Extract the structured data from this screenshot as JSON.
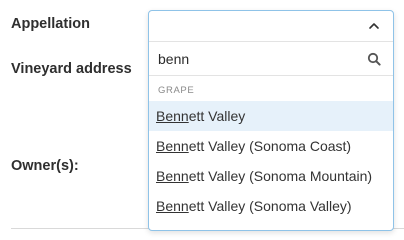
{
  "form": {
    "appellation_label": "Appellation",
    "vineyard_address_label": "Vineyard address",
    "owner_label": "Owner(s):"
  },
  "dropdown": {
    "search_value": "benn",
    "group_label": "GRAPE",
    "highlight_color": "#e6f1fa",
    "border_color": "#8fc3e8",
    "options": [
      {
        "match": "Benn",
        "rest": "ett Valley",
        "highlighted": true
      },
      {
        "match": "Benn",
        "rest": "ett Valley (Sonoma Coast)",
        "highlighted": false
      },
      {
        "match": "Benn",
        "rest": "ett Valley (Sonoma Mountain)",
        "highlighted": false
      },
      {
        "match": "Benn",
        "rest": "ett Valley (Sonoma Valley)",
        "highlighted": false
      }
    ]
  },
  "icons": {
    "toggle": "chevron-up-icon",
    "search": "search-icon"
  }
}
